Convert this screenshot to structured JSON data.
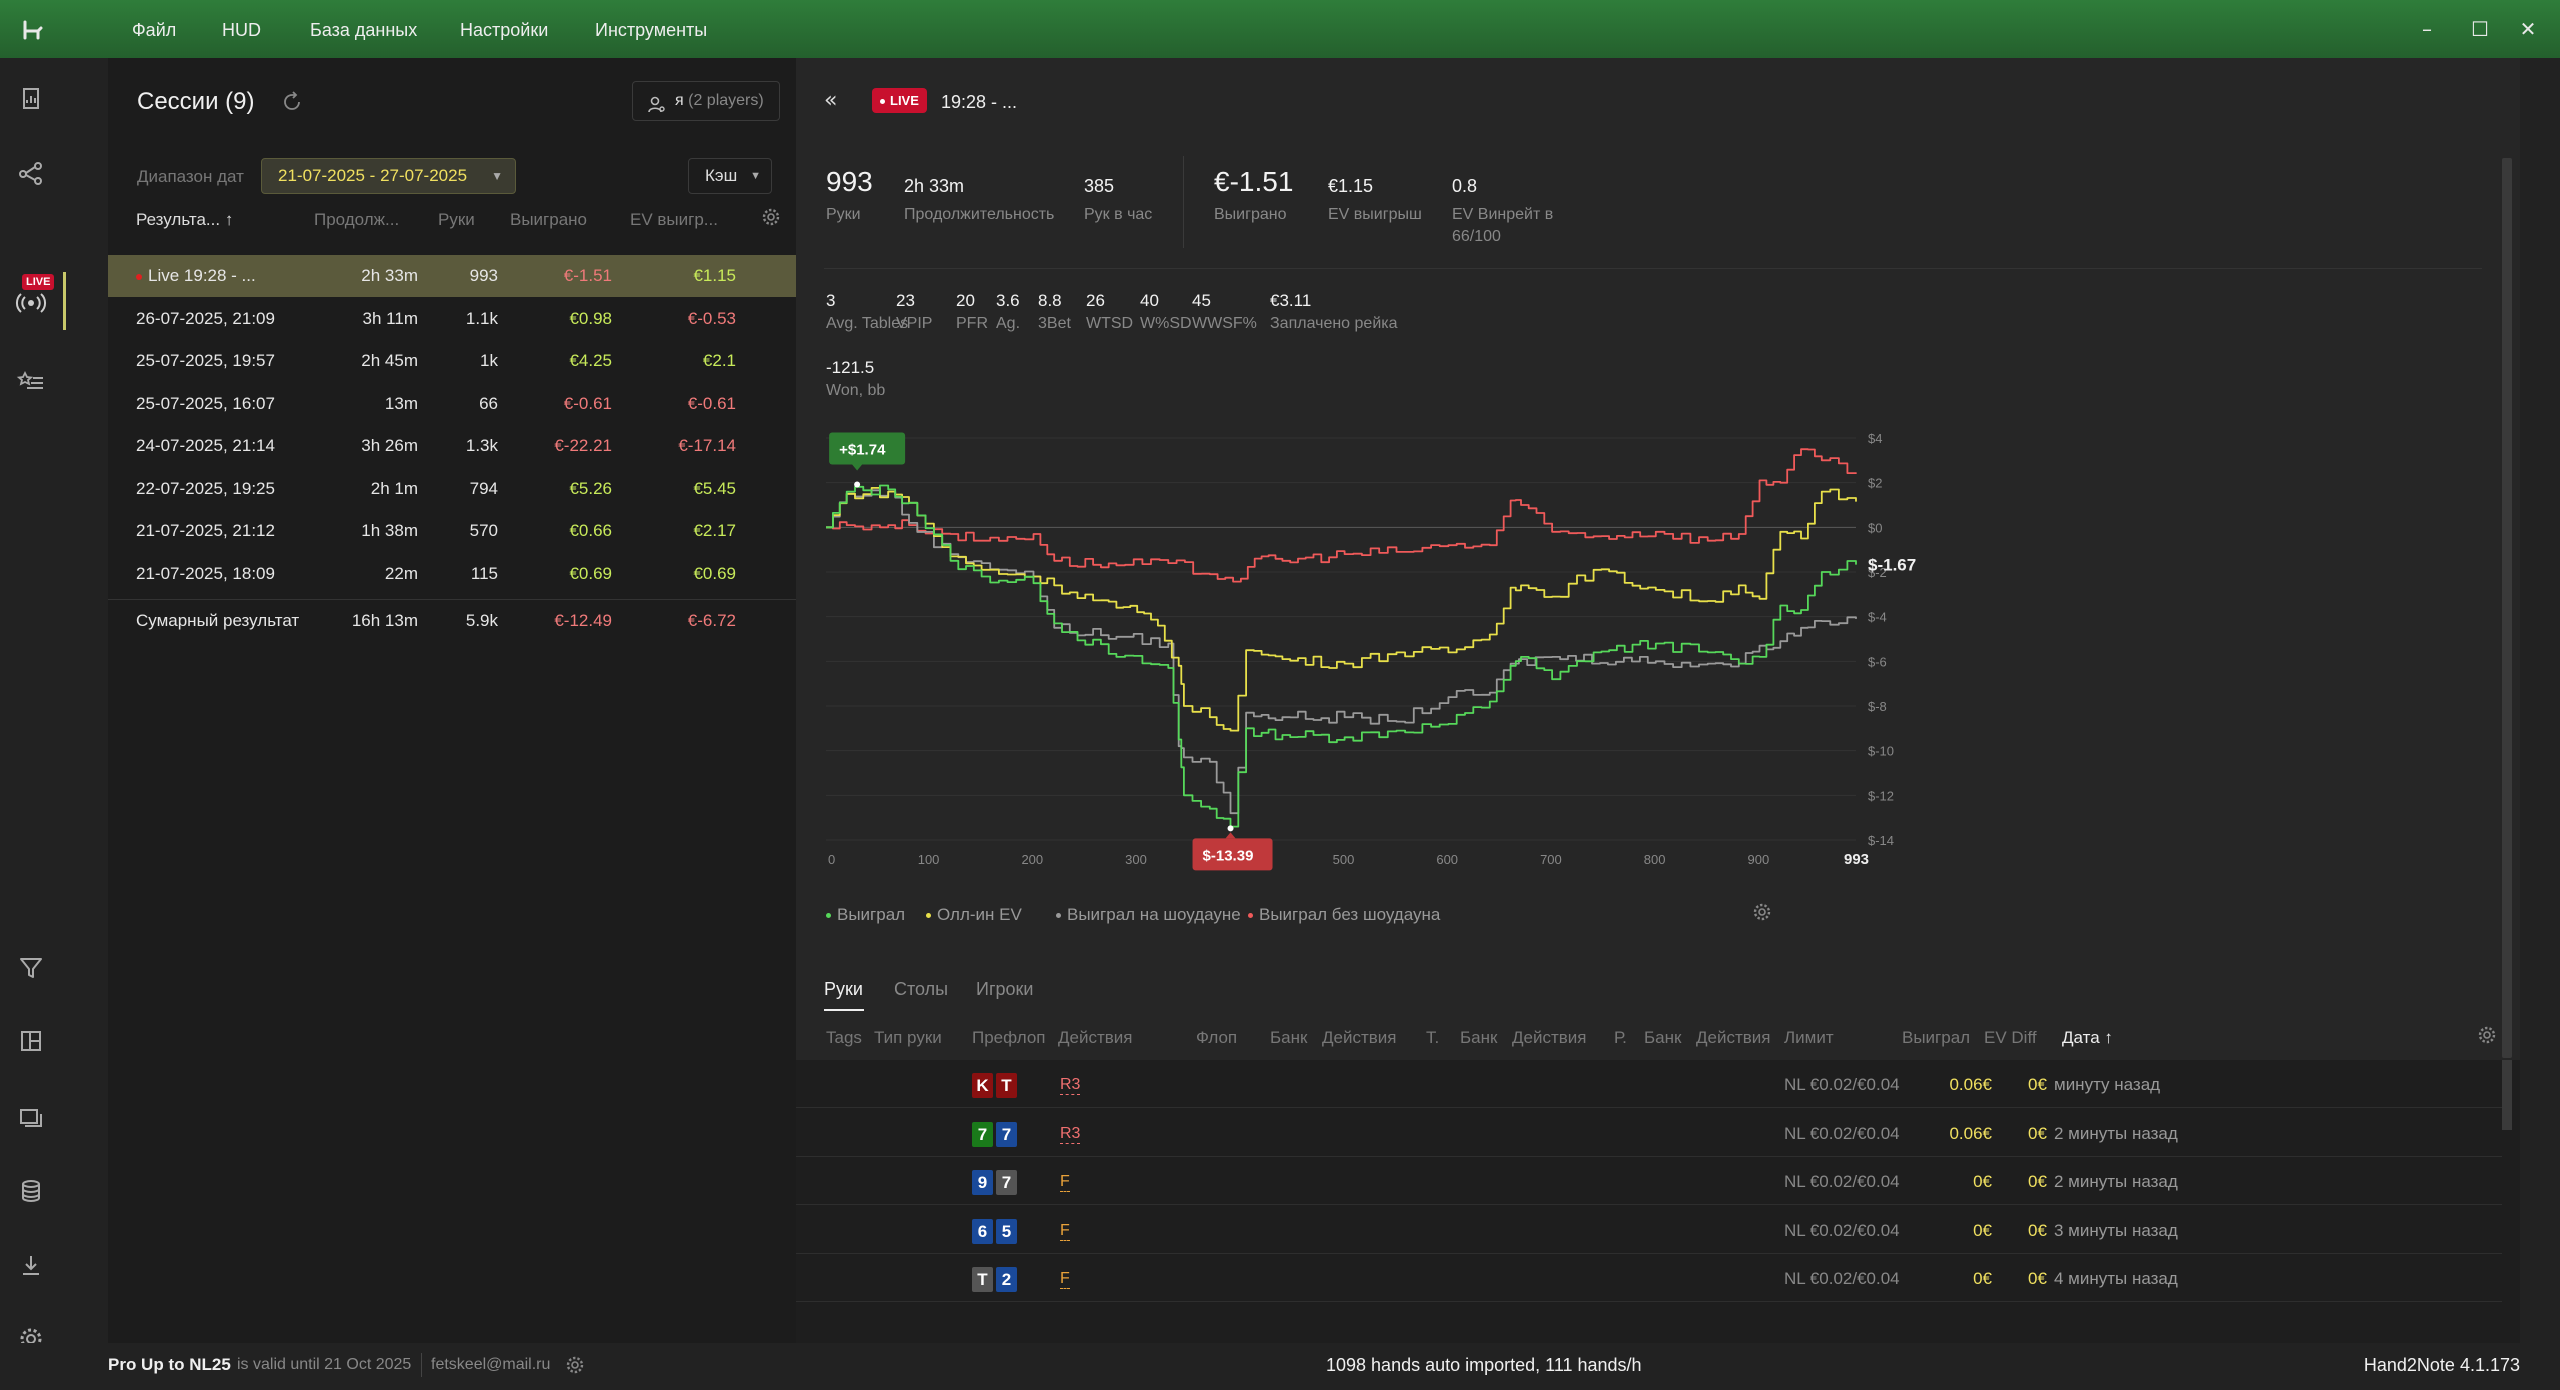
{
  "menu": [
    "Файл",
    "HUD",
    "База данных",
    "Настройки",
    "Инструменты"
  ],
  "sessions": {
    "title": "Сессии (9)",
    "players_me": "я",
    "players_count": "(2 players)",
    "range_label": "Диапазон дат",
    "range_value": "21-07-2025 - 27-07-2025",
    "cash_value": "Кэш",
    "columns": {
      "result": "Результа...",
      "duration": "Продолж...",
      "hands": "Руки",
      "won": "Выиграно",
      "ev": "EV выигр..."
    },
    "rows": [
      {
        "name": "Live 19:28 - ...",
        "duration": "2h 33m",
        "hands": "993",
        "won": "€-1.51",
        "ev": "€1.15",
        "won_neg": true,
        "ev_neg": false,
        "live": true
      },
      {
        "name": "26-07-2025, 21:09",
        "duration": "3h 11m",
        "hands": "1.1k",
        "won": "€0.98",
        "ev": "€-0.53",
        "won_neg": false,
        "ev_neg": true
      },
      {
        "name": "25-07-2025, 19:57",
        "duration": "2h 45m",
        "hands": "1k",
        "won": "€4.25",
        "ev": "€2.1",
        "won_neg": false,
        "ev_neg": false
      },
      {
        "name": "25-07-2025, 16:07",
        "duration": "13m",
        "hands": "66",
        "won": "€-0.61",
        "ev": "€-0.61",
        "won_neg": true,
        "ev_neg": true
      },
      {
        "name": "24-07-2025, 21:14",
        "duration": "3h 26m",
        "hands": "1.3k",
        "won": "€-22.21",
        "ev": "€-17.14",
        "won_neg": true,
        "ev_neg": true
      },
      {
        "name": "22-07-2025, 19:25",
        "duration": "2h 1m",
        "hands": "794",
        "won": "€5.26",
        "ev": "€5.45",
        "won_neg": false,
        "ev_neg": false
      },
      {
        "name": "21-07-2025, 21:12",
        "duration": "1h 38m",
        "hands": "570",
        "won": "€0.66",
        "ev": "€2.17",
        "won_neg": false,
        "ev_neg": false
      },
      {
        "name": "21-07-2025, 18:09",
        "duration": "22m",
        "hands": "115",
        "won": "€0.69",
        "ev": "€0.69",
        "won_neg": false,
        "ev_neg": false
      }
    ],
    "total": {
      "name": "Сумарный результат",
      "duration": "16h 13m",
      "hands": "5.9k",
      "won": "€-12.49",
      "ev": "€-6.72"
    }
  },
  "live": {
    "badge": "LIVE",
    "title": "19:28 - ...",
    "stats_top": {
      "hands": "993",
      "hands_label": "Руки",
      "duration": "2h 33m",
      "duration_label": "Продолжительность",
      "rate": "385",
      "rate_label": "Рук в час",
      "won": "€-1.51",
      "won_label": "Выиграно",
      "ev": "€1.15",
      "ev_label": "EV выигрыш",
      "evbb": "0.8",
      "evbb_label": "EV Винрейт в 66/100"
    },
    "stats_row": [
      {
        "value": "3",
        "label": "Avg. Tables"
      },
      {
        "value": "23",
        "label": "VPIP"
      },
      {
        "value": "20",
        "label": "PFR"
      },
      {
        "value": "3.6",
        "label": "Ag."
      },
      {
        "value": "8.8",
        "label": "3Bet"
      },
      {
        "value": "26",
        "label": "WTSD"
      },
      {
        "value": "40",
        "label": "W%SD"
      },
      {
        "value": "45",
        "label": "WWSF%"
      },
      {
        "value": "€3.11",
        "label": "Заплачено рейка"
      }
    ],
    "won_bb": {
      "value": "-121.5",
      "label": "Won, bb"
    }
  },
  "chart_data": {
    "type": "line",
    "x_range": [
      0,
      993
    ],
    "x_ticks": [
      "0",
      "100",
      "200",
      "300",
      "400",
      "500",
      "600",
      "700",
      "800",
      "900"
    ],
    "x_end_label": "993",
    "y_range": [
      -14,
      4
    ],
    "y_ticks": [
      "$4",
      "$2",
      "$0",
      "$-2",
      "$-4",
      "$-6",
      "$-8",
      "$-10",
      "$-12",
      "$-14"
    ],
    "max_label": "+$1.74",
    "min_label": "$-13.39",
    "end_label": "$-1.67",
    "grid": true,
    "series": [
      {
        "name": "Выиграл",
        "color": "#56d85a",
        "x": [
          0,
          20,
          60,
          80,
          120,
          150,
          200,
          220,
          280,
          330,
          340,
          345,
          370,
          390,
          405,
          420,
          440,
          500,
          550,
          600,
          640,
          660,
          670,
          700,
          740,
          800,
          850,
          880,
          900,
          920,
          940,
          960,
          993
        ],
        "y": [
          0,
          1.6,
          1.7,
          1.1,
          -1.5,
          -2.2,
          -2.5,
          -4.3,
          -5.8,
          -6.3,
          -9.5,
          -12,
          -12.6,
          -13.4,
          -9,
          -9.2,
          -9.3,
          -9.4,
          -9.1,
          -8.8,
          -7.8,
          -6.2,
          -5.8,
          -6.8,
          -5.6,
          -5.2,
          -5.6,
          -6.1,
          -5.8,
          -3.5,
          -3.7,
          -2,
          -1.67
        ]
      },
      {
        "name": "Олл-ин EV",
        "color": "#e8e04a",
        "x": [
          0,
          20,
          60,
          80,
          120,
          150,
          200,
          220,
          280,
          300,
          320,
          340,
          345,
          370,
          390,
          405,
          420,
          440,
          500,
          550,
          600,
          640,
          660,
          670,
          700,
          740,
          800,
          850,
          880,
          900,
          920,
          940,
          960,
          993
        ],
        "y": [
          0,
          1.5,
          1.6,
          1.1,
          -1.3,
          -1.9,
          -2.2,
          -2.6,
          -3.6,
          -3.8,
          -4.4,
          -6.2,
          -8,
          -8.5,
          -9.1,
          -5.5,
          -5.7,
          -5.9,
          -6.1,
          -5.6,
          -5.6,
          -4.8,
          -2.7,
          -2.6,
          -3.1,
          -1.9,
          -2.8,
          -3.3,
          -2.6,
          -3.2,
          -0.2,
          -0.5,
          1.6,
          1.15
        ]
      },
      {
        "name": "Выиграл на шоудауне",
        "color": "#9a9a9a",
        "x": [
          0,
          20,
          60,
          80,
          120,
          150,
          200,
          220,
          280,
          330,
          340,
          345,
          370,
          390,
          405,
          420,
          440,
          500,
          550,
          600,
          640,
          660,
          700,
          800,
          850,
          880,
          900,
          920,
          940,
          960,
          993
        ],
        "y": [
          0,
          1.5,
          1.6,
          0.2,
          -1.2,
          -1.6,
          -2.2,
          -4.5,
          -4.9,
          -5.2,
          -9.8,
          -10.3,
          -10.5,
          -12.8,
          -8.3,
          -8.4,
          -8.5,
          -8.5,
          -8.7,
          -7.6,
          -7.4,
          -6.1,
          -5.8,
          -6,
          -6.1,
          -6.1,
          -5.3,
          -5.1,
          -4.5,
          -4.2,
          -4.1
        ]
      },
      {
        "name": "Выиграл без шоудауна",
        "color": "#f05a5a",
        "x": [
          0,
          20,
          60,
          80,
          120,
          150,
          200,
          220,
          280,
          330,
          370,
          400,
          420,
          440,
          500,
          550,
          600,
          640,
          660,
          670,
          700,
          740,
          800,
          850,
          880,
          900,
          920,
          940,
          960,
          993
        ],
        "y": [
          0,
          0.1,
          0.1,
          0.1,
          -0.3,
          -0.6,
          -0.3,
          -1.5,
          -1.7,
          -1.6,
          -2.1,
          -2.3,
          -1.3,
          -1.5,
          -1.2,
          -1.1,
          -0.8,
          -0.8,
          1.2,
          1,
          -0.2,
          -0.4,
          -0.2,
          -0.6,
          -0.3,
          2.1,
          2,
          3.5,
          3,
          2.4
        ]
      }
    ]
  },
  "legend": [
    "Выиграл",
    "Олл-ин EV",
    "Выиграл на шоудауне",
    "Выиграл без шоудауна"
  ],
  "colors": {
    "won": "#56d85a",
    "ev": "#e8e04a",
    "showdown": "#9a9a9a",
    "nonshowdown": "#f05a5a",
    "accent": "#c8102e"
  },
  "tabs": [
    "Руки",
    "Столы",
    "Игроки"
  ],
  "hands_columns": [
    "Tags",
    "Тип руки",
    "Префлоп",
    "Действия",
    "Флоп",
    "Банк",
    "Действия",
    "Т.",
    "Банк",
    "Действия",
    "Р.",
    "Банк",
    "Действия",
    "Лимит",
    "Выиграл",
    "EV Diff",
    "Дата ↑"
  ],
  "hands": [
    {
      "cards": [
        {
          "r": "K",
          "c": "#8a1010"
        },
        {
          "r": "T",
          "c": "#8a1010"
        }
      ],
      "action": "R3",
      "limit": "NL €0.02/€0.04",
      "won": "0.06€",
      "ev": "0€",
      "date": "минуту назад"
    },
    {
      "cards": [
        {
          "r": "7",
          "c": "#1a7a1a"
        },
        {
          "r": "7",
          "c": "#1a4a9a"
        }
      ],
      "action": "R3",
      "limit": "NL €0.02/€0.04",
      "won": "0.06€",
      "ev": "0€",
      "date": "2 минуты назад"
    },
    {
      "cards": [
        {
          "r": "9",
          "c": "#1a4a9a"
        },
        {
          "r": "7",
          "c": "#555555"
        }
      ],
      "action": "F",
      "limit": "NL €0.02/€0.04",
      "won": "0€",
      "ev": "0€",
      "date": "2 минуты назад"
    },
    {
      "cards": [
        {
          "r": "6",
          "c": "#1a4a9a"
        },
        {
          "r": "5",
          "c": "#1a4a9a"
        }
      ],
      "action": "F",
      "limit": "NL €0.02/€0.04",
      "won": "0€",
      "ev": "0€",
      "date": "3 минуты назад"
    },
    {
      "cards": [
        {
          "r": "T",
          "c": "#555555"
        },
        {
          "r": "2",
          "c": "#1a4a9a"
        }
      ],
      "action": "F",
      "limit": "NL €0.02/€0.04",
      "won": "0€",
      "ev": "0€",
      "date": "4 минуты назад"
    }
  ],
  "footer": {
    "license": "Pro Up to NL25",
    "valid": "is valid until 21 Oct 2025",
    "email": "fetskeel@mail.ru",
    "status": "1098 hands auto imported, 111 hands/h",
    "version": "Hand2Note 4.1.173"
  }
}
